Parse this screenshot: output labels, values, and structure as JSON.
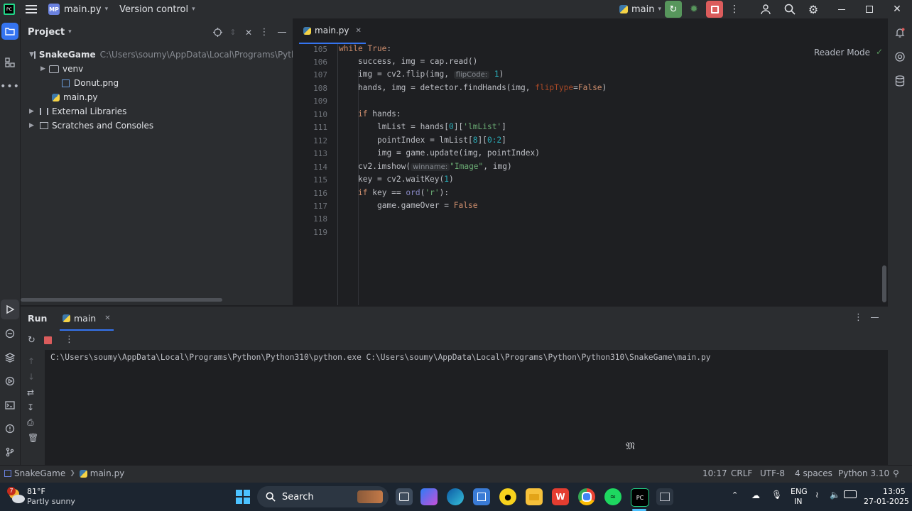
{
  "titlebar": {
    "project_badge": "MP",
    "project_name": "main.py",
    "vcs_label": "Version control",
    "run_config": "main"
  },
  "project_panel": {
    "title": "Project",
    "tree": [
      {
        "label": "SnakeGame",
        "extra": "C:\\Users\\soumy\\AppData\\Local\\Programs\\Python\\P"
      },
      {
        "label": "venv"
      },
      {
        "label": "Donut.png"
      },
      {
        "label": "main.py"
      },
      {
        "label": "External Libraries"
      },
      {
        "label": "Scratches and Consoles"
      }
    ]
  },
  "editor": {
    "tab_label": "main.py",
    "reader_mode": "Reader Mode",
    "line_numbers": [
      "105",
      "106",
      "107",
      "108",
      "109",
      "110",
      "111",
      "112",
      "113",
      "114",
      "115",
      "116",
      "117",
      "118",
      "119"
    ],
    "code": {
      "l105_kw": "while",
      "l105_val": "True",
      "l106": "success, img = cap.read()",
      "l107_a": "img = cv2.flip(img, ",
      "l107_hint": "flipCode:",
      "l107_num": "1",
      "l108_a": "hands, img = detector.findHands(img, ",
      "l108_kw": "flipType",
      "l108_val": "False",
      "l110_kw": "if",
      "l110_b": "hands:",
      "l111_a": "lmList = hands[",
      "l111_num": "0",
      "l111_str": "'lmList'",
      "l112_a": "pointIndex = lmList[",
      "l112_num": "8",
      "l112_slice": "0:2",
      "l113": "img = game.update(img, pointIndex)",
      "l114_a": "cv2.imshow(",
      "l114_hint": "winname:",
      "l114_str": "\"Image\"",
      "l114_b": ", img)",
      "l115_a": "key = cv2.waitKey(",
      "l115_num": "1",
      "l116_kw": "if",
      "l116_b": "key == ",
      "l116_fn": "ord",
      "l116_str": "'r'",
      "l117_a": "game.gameOver = ",
      "l117_val": "False"
    }
  },
  "run_panel": {
    "title": "Run",
    "tab_label": "main",
    "console_line": "C:\\Users\\soumy\\AppData\\Local\\Programs\\Python\\Python310\\python.exe C:\\Users\\soumy\\AppData\\Local\\Programs\\Python\\Python310\\SnakeGame\\main.py"
  },
  "statusbar": {
    "crumb_project": "SnakeGame",
    "crumb_file": "main.py",
    "position": "10:17",
    "line_sep": "CRLF",
    "encoding": "UTF-8",
    "indent": "4 spaces",
    "interpreter": "Python 3.10"
  },
  "taskbar": {
    "weather_temp": "81°F",
    "weather_desc": "Partly sunny",
    "search_label": "Search",
    "lang_1": "ENG",
    "lang_2": "IN",
    "time": "13:05",
    "date": "27-01-2025",
    "weather_badge": "7"
  },
  "colors": {
    "accent": "#3574f0",
    "run_green": "#57965c",
    "stop_red": "#db5c5c"
  }
}
